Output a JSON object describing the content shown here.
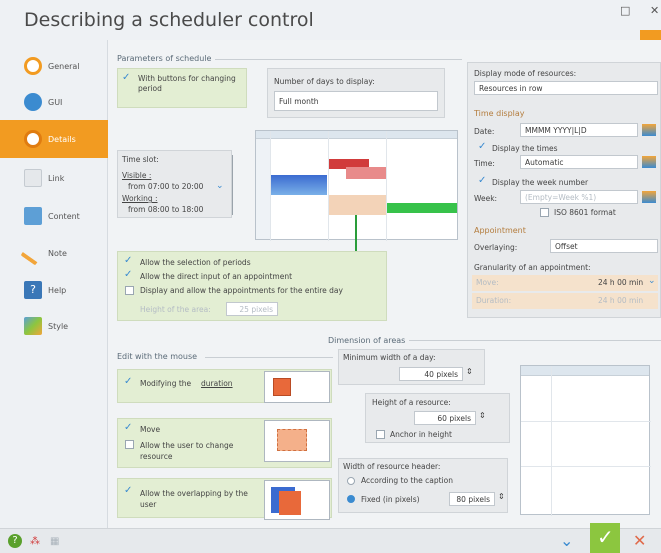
{
  "window": {
    "title": "Describing a scheduler control",
    "restore": "□",
    "close": "✕"
  },
  "sidebar": {
    "items": [
      {
        "label": "General",
        "icon": "general-icon"
      },
      {
        "label": "GUI",
        "icon": "gui-icon"
      },
      {
        "label": "Details",
        "icon": "details-icon",
        "active": true
      },
      {
        "label": "Link",
        "icon": "link-icon"
      },
      {
        "label": "Content",
        "icon": "content-icon"
      },
      {
        "label": "Note",
        "icon": "note-icon"
      },
      {
        "label": "Help",
        "icon": "help-icon"
      },
      {
        "label": "Style",
        "icon": "style-icon"
      }
    ]
  },
  "params": {
    "title": "Parameters of schedule",
    "with_buttons": "With buttons for changing period",
    "days_label": "Number of days to display:",
    "days_value": "Full month",
    "time_slot": "Time slot:",
    "visible": "Visible :",
    "visible_range": "from 07:00 to 20:00",
    "working": "Working :",
    "working_range": "from 08:00 to 18:00",
    "allow_selection": "Allow the selection of periods",
    "allow_direct": "Allow the direct input of an appointment",
    "display_entire_day": "Display and allow the appointments for the entire day",
    "height_area": "Height of the area:",
    "height_area_value": "25 pixels"
  },
  "right_panel": {
    "display_mode_label": "Display mode of resources:",
    "display_mode_value": "Resources in row",
    "time_display": "Time display",
    "date_label": "Date:",
    "date_value": "MMMM YYYY|L|D",
    "display_times": "Display the times",
    "time_label": "Time:",
    "time_value": "Automatic",
    "display_week": "Display the week number",
    "week_label": "Week:",
    "week_value": "(Empty=Week %1)",
    "iso": "ISO 8601 format",
    "appointment": "Appointment",
    "overlaying_label": "Overlaying:",
    "overlaying_value": "Offset",
    "granularity": "Granularity of an appointment:",
    "move_label": "Move:",
    "move_value": "24 h 00 min",
    "duration_label": "Duration:",
    "duration_value": "24 h 00 min"
  },
  "mouse": {
    "title": "Edit with the mouse",
    "modifying": "Modifying the",
    "duration": "duration",
    "move": "Move",
    "allow_change": "Allow the user to change resource",
    "allow_overlap": "Allow the overlapping by the user"
  },
  "dimension": {
    "title": "Dimension of areas",
    "min_width_label": "Minimum width of a day:",
    "min_width_value": "40 pixels",
    "height_res_label": "Height of a resource:",
    "height_res_value": "60 pixels",
    "anchor": "Anchor in height",
    "header_width_label": "Width of resource header:",
    "according": "According to the caption",
    "fixed": "Fixed (in pixels)",
    "fixed_value": "80 pixels"
  },
  "colors": {
    "accent": "#f29b21",
    "green": "#8cc63f",
    "blue": "#3b8bd0"
  }
}
